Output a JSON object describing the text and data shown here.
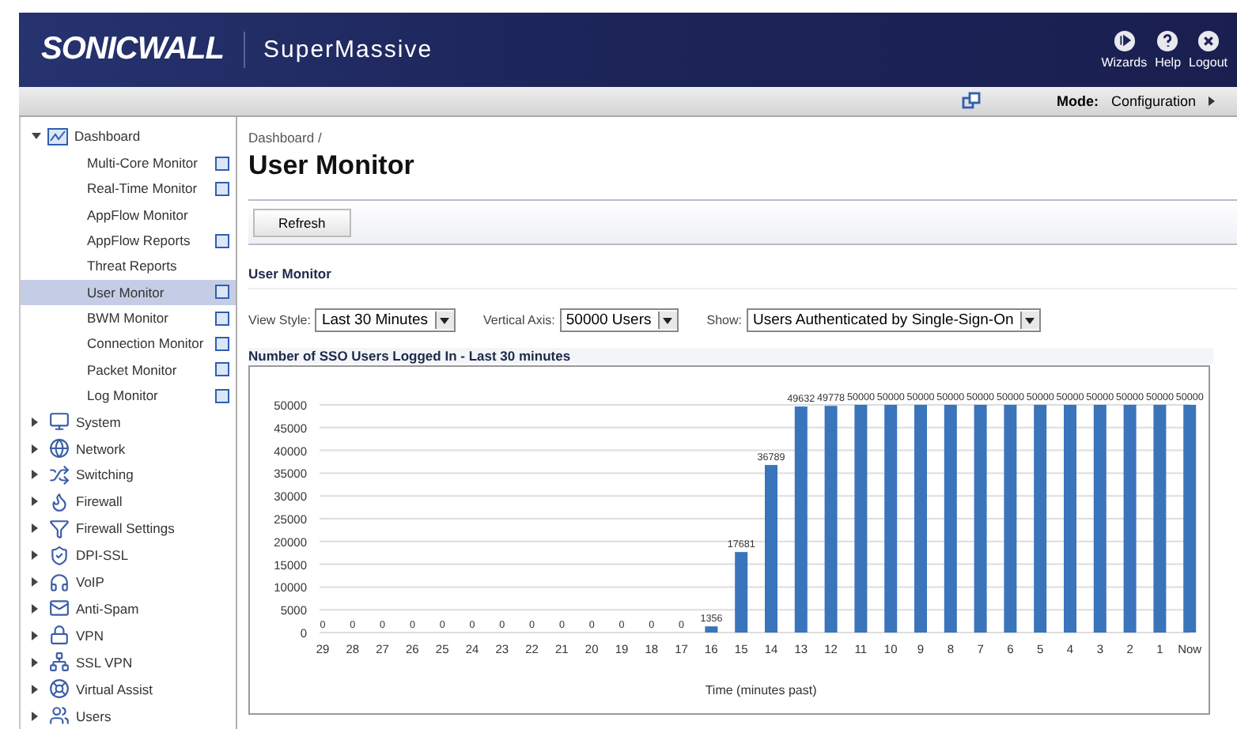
{
  "header": {
    "brand": "SONICWALL",
    "product": "SuperMassive",
    "actions": [
      {
        "kind": "wizards",
        "label": "Wizards"
      },
      {
        "kind": "help",
        "label": "Help"
      },
      {
        "kind": "logout",
        "label": "Logout"
      }
    ]
  },
  "toolbar": {
    "mode_label": "Mode:",
    "mode_value": "Configuration"
  },
  "sidebar": {
    "items": [
      {
        "label": "Dashboard",
        "expanded": true,
        "children": [
          {
            "label": "Multi-Core Monitor",
            "selected": false,
            "popout": true
          },
          {
            "label": "Real-Time Monitor",
            "selected": false,
            "popout": true
          },
          {
            "label": "AppFlow Monitor",
            "selected": false,
            "popout": false
          },
          {
            "label": "AppFlow Reports",
            "selected": false,
            "popout": true
          },
          {
            "label": "Threat Reports",
            "selected": false,
            "popout": false
          },
          {
            "label": "User Monitor",
            "selected": true,
            "popout": true
          },
          {
            "label": "BWM Monitor",
            "selected": false,
            "popout": true
          },
          {
            "label": "Connection Monitor",
            "selected": false,
            "popout": true
          },
          {
            "label": "Packet Monitor",
            "selected": false,
            "popout": true
          },
          {
            "label": "Log Monitor",
            "selected": false,
            "popout": true
          }
        ]
      },
      {
        "label": "System",
        "expanded": false
      },
      {
        "label": "Network",
        "expanded": false
      },
      {
        "label": "Switching",
        "expanded": false
      },
      {
        "label": "Firewall",
        "expanded": false
      },
      {
        "label": "Firewall Settings",
        "expanded": false
      },
      {
        "label": "DPI-SSL",
        "expanded": false
      },
      {
        "label": "VoIP",
        "expanded": false
      },
      {
        "label": "Anti-Spam",
        "expanded": false
      },
      {
        "label": "VPN",
        "expanded": false
      },
      {
        "label": "SSL VPN",
        "expanded": false
      },
      {
        "label": "Virtual Assist",
        "expanded": false
      },
      {
        "label": "Users",
        "expanded": false
      }
    ]
  },
  "content": {
    "breadcrumb": "Dashboard /",
    "title": "User Monitor",
    "refresh_button": "Refresh",
    "section_title": "User Monitor",
    "filters": [
      {
        "label": "View Style:",
        "value": "Last 30 Minutes"
      },
      {
        "label": "Vertical Axis:",
        "value": "50000 Users"
      },
      {
        "label": "Show:",
        "value": "Users Authenticated by Single-Sign-On"
      }
    ],
    "chart_title": "Number of SSO Users Logged In - Last 30 minutes",
    "chart_data": {
      "type": "bar",
      "xlabel": "Time (minutes past)",
      "categories": [
        "29",
        "28",
        "27",
        "26",
        "25",
        "24",
        "23",
        "22",
        "21",
        "20",
        "19",
        "18",
        "17",
        "16",
        "15",
        "14",
        "13",
        "12",
        "11",
        "10",
        "9",
        "8",
        "7",
        "6",
        "5",
        "4",
        "3",
        "2",
        "1",
        "Now"
      ],
      "series": [
        {
          "color": "#3a74bb",
          "values": [
            0,
            0,
            0,
            0,
            0,
            0,
            0,
            0,
            0,
            0,
            0,
            0,
            0,
            1356,
            17681,
            36789,
            49632,
            49778,
            50000,
            50000,
            50000,
            50000,
            50000,
            50000,
            50000,
            50000,
            50000,
            50000,
            50000,
            50000
          ]
        }
      ],
      "ylim": [
        0,
        50000
      ],
      "yticks": [
        0,
        5000,
        10000,
        15000,
        20000,
        25000,
        30000,
        35000,
        40000,
        45000,
        50000
      ],
      "data_labels": true,
      "grid": true
    }
  }
}
